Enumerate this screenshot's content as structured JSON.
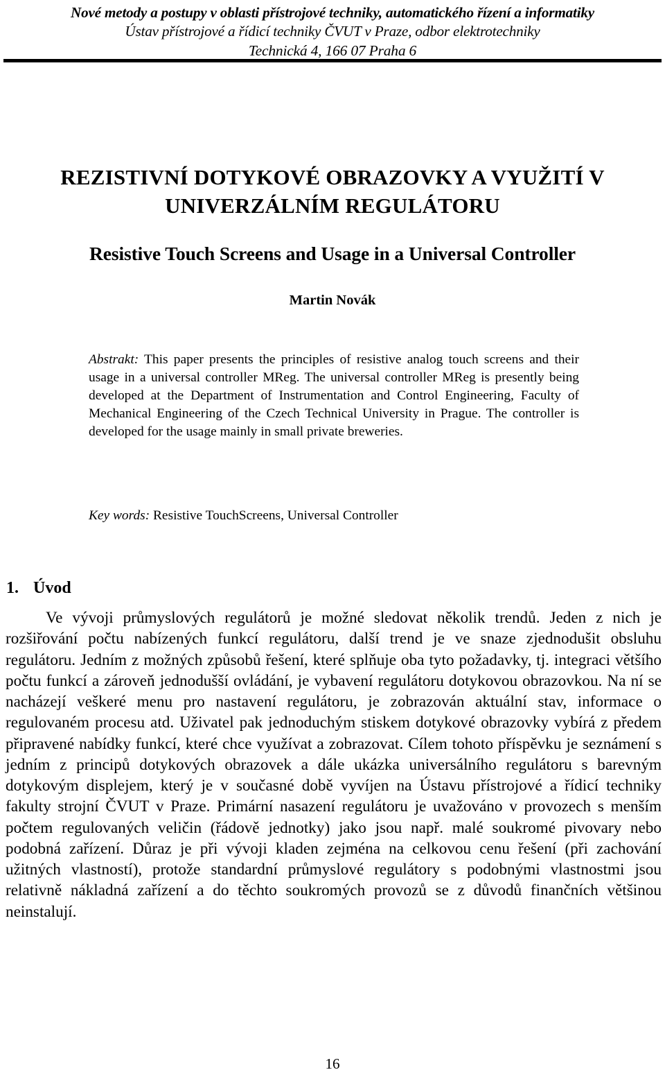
{
  "header": {
    "line1": "Nové metody a postupy v oblasti přístrojové techniky, automatického řízení a informatiky",
    "line2": "Ústav přístrojové a řídicí techniky ČVUT v Praze, odbor elektrotechniky",
    "line3": "Technická 4, 166 07 Praha 6"
  },
  "title": {
    "czech": "REZISTIVNÍ DOTYKOVÉ OBRAZOVKY A VYUŽITÍ V UNIVERZÁLNÍM REGULÁTORU",
    "english": "Resistive Touch Screens and Usage in a Universal Controller",
    "author": "Martin Novák"
  },
  "abstract": {
    "lead": "Abstrakt:",
    "text": " This paper presents the principles of resistive analog touch screens and their usage in a universal controller MReg. The universal controller MReg is presently being developed at the Department of Instrumentation and Control Engineering, Faculty of Mechanical Engineering of the Czech Technical University in Prague.  The controller is developed for the usage mainly in small private breweries."
  },
  "keywords": {
    "lead": "Key words:",
    "text": " Resistive TouchScreens, Universal Controller"
  },
  "section": {
    "number": "1.",
    "title": "Úvod"
  },
  "body": {
    "paragraph": "Ve vývoji průmyslových regulátorů je možné sledovat několik trendů. Jeden z nich je rozšiřování počtu nabízených funkcí regulátoru, další trend je ve snaze zjednodušit obsluhu regulátoru. Jedním z možných způsobů řešení, které splňuje oba tyto požadavky, tj. integraci většího počtu funkcí a zároveň jednodušší ovládání, je vybavení regulátoru dotykovou obrazovkou. Na ní se nacházejí veškeré menu pro nastavení regulátoru, je zobrazován aktuální stav, informace o regulovaném procesu atd. Uživatel pak jednoduchým stiskem dotykové obrazovky vybírá z předem připravené nabídky funkcí, které chce využívat a zobrazovat. Cílem tohoto příspěvku je seznámení s jedním z principů dotykových obrazovek a dále ukázka universálního regulátoru s barevným dotykovým displejem, který je v současné době vyvíjen na Ústavu přístrojové a řídicí techniky fakulty strojní ČVUT v Praze. Primární nasazení regulátoru je uvažováno v provozech s menším počtem regulovaných veličin (řádově jednotky) jako jsou např. malé soukromé pivovary nebo podobná zařízení. Důraz je při vývoji kladen zejména na celkovou cenu řešení (při zachování užitných vlastností), protože standardní průmyslové regulátory s podobnými vlastnostmi jsou relativně nákladná zařízení a do těchto soukromých provozů se z důvodů finančních většinou neinstalují."
  },
  "footer": {
    "page_number": "16"
  }
}
